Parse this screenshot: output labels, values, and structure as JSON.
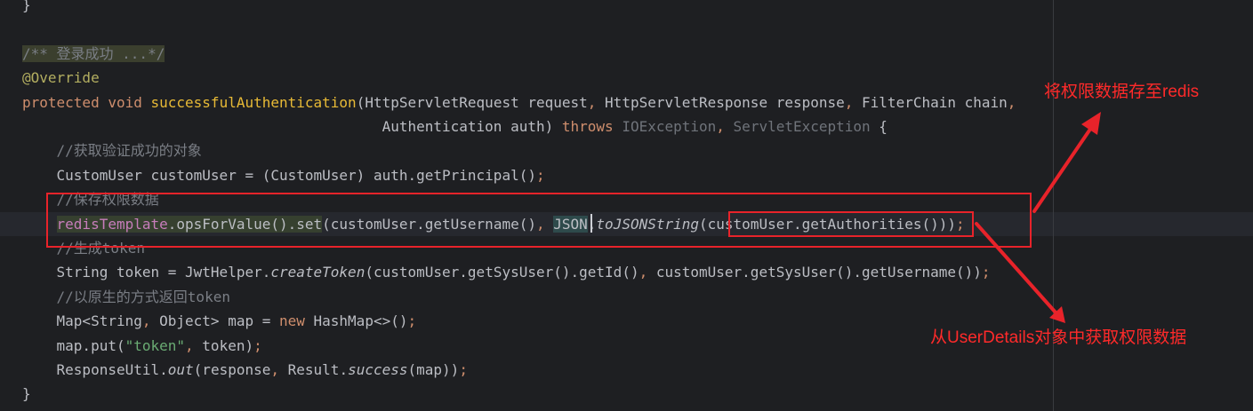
{
  "editor": {
    "lines": [
      {
        "tokens": [
          {
            "t": "}",
            "c": "plain"
          }
        ]
      },
      {
        "tokens": []
      },
      {
        "tokens": [
          {
            "t": "/** 登录成功 ...*/",
            "c": "fold"
          }
        ]
      },
      {
        "tokens": [
          {
            "t": "@Override",
            "c": "ann"
          }
        ]
      },
      {
        "tokens": [
          {
            "t": "protected ",
            "c": "kw"
          },
          {
            "t": "void ",
            "c": "kw"
          },
          {
            "t": "successfulAuthentication",
            "c": "fndecl"
          },
          {
            "t": "(HttpServletRequest request",
            "c": "plain"
          },
          {
            "t": ", ",
            "c": "punc"
          },
          {
            "t": "HttpServletResponse response",
            "c": "plain"
          },
          {
            "t": ", ",
            "c": "punc"
          },
          {
            "t": "FilterChain chain",
            "c": "plain"
          },
          {
            "t": ",",
            "c": "punc"
          }
        ]
      },
      {
        "tokens": [
          {
            "t": "                                          Authentication auth) ",
            "c": "plain"
          },
          {
            "t": "throws ",
            "c": "kw"
          },
          {
            "t": "IOException",
            "c": "unused"
          },
          {
            "t": ", ",
            "c": "punc"
          },
          {
            "t": "ServletException",
            "c": "unused"
          },
          {
            "t": " {",
            "c": "plain"
          }
        ]
      },
      {
        "tokens": [
          {
            "t": "    ",
            "c": "plain"
          },
          {
            "t": "//获取验证成功的对象",
            "c": "cm"
          }
        ]
      },
      {
        "tokens": [
          {
            "t": "    CustomUser customUser = (CustomUser) auth.getPrincipal()",
            "c": "plain"
          },
          {
            "t": ";",
            "c": "punc"
          }
        ]
      },
      {
        "tokens": [
          {
            "t": "    ",
            "c": "plain"
          },
          {
            "t": "//保存权限数据",
            "c": "cm"
          }
        ]
      },
      {
        "current": true,
        "tokens": [
          {
            "t": "    ",
            "c": "plain"
          },
          {
            "t": "redisTemplate",
            "c": "field",
            "hl": "usage"
          },
          {
            "t": ".opsForValue().set",
            "c": "plain",
            "hl": "usage"
          },
          {
            "t": "(customUser.getUsername()",
            "c": "plain"
          },
          {
            "t": ", ",
            "c": "punc"
          },
          {
            "t": "JSON",
            "c": "plain",
            "hl": "usage2"
          },
          {
            "t": ".",
            "c": "plain"
          },
          {
            "t": "toJSONString",
            "c": "static"
          },
          {
            "t": "(customUser.getAuthorities()))",
            "c": "plain"
          },
          {
            "t": ";",
            "c": "punc"
          }
        ]
      },
      {
        "tokens": [
          {
            "t": "    ",
            "c": "plain"
          },
          {
            "t": "//生成token",
            "c": "cm"
          }
        ]
      },
      {
        "tokens": [
          {
            "t": "    String token = JwtHelper.",
            "c": "plain"
          },
          {
            "t": "createToken",
            "c": "static"
          },
          {
            "t": "(customUser.getSysUser().getId()",
            "c": "plain"
          },
          {
            "t": ", ",
            "c": "punc"
          },
          {
            "t": "customUser.getSysUser().getUsername())",
            "c": "plain"
          },
          {
            "t": ";",
            "c": "punc"
          }
        ]
      },
      {
        "tokens": [
          {
            "t": "    ",
            "c": "plain"
          },
          {
            "t": "//以原生的方式返回token",
            "c": "cm"
          }
        ]
      },
      {
        "tokens": [
          {
            "t": "    Map<String",
            "c": "plain"
          },
          {
            "t": ", ",
            "c": "punc"
          },
          {
            "t": "Object> map = ",
            "c": "plain"
          },
          {
            "t": "new ",
            "c": "kw"
          },
          {
            "t": "HashMap<>()",
            "c": "plain"
          },
          {
            "t": ";",
            "c": "punc"
          }
        ]
      },
      {
        "tokens": [
          {
            "t": "    map.put(",
            "c": "plain"
          },
          {
            "t": "\"token\"",
            "c": "str"
          },
          {
            "t": ", ",
            "c": "punc"
          },
          {
            "t": "token)",
            "c": "plain"
          },
          {
            "t": ";",
            "c": "punc"
          }
        ]
      },
      {
        "tokens": [
          {
            "t": "    ResponseUtil.",
            "c": "plain"
          },
          {
            "t": "out",
            "c": "static"
          },
          {
            "t": "(response",
            "c": "plain"
          },
          {
            "t": ", ",
            "c": "punc"
          },
          {
            "t": "Result.",
            "c": "plain"
          },
          {
            "t": "success",
            "c": "static"
          },
          {
            "t": "(map))",
            "c": "plain"
          },
          {
            "t": ";",
            "c": "punc"
          }
        ]
      },
      {
        "tokens": [
          {
            "t": "}",
            "c": "plain"
          }
        ]
      }
    ]
  },
  "annotations": {
    "top_note": "将权限数据存至redis",
    "bottom_note": "从UserDetails对象中获取权限数据",
    "color": "#e8232a"
  }
}
